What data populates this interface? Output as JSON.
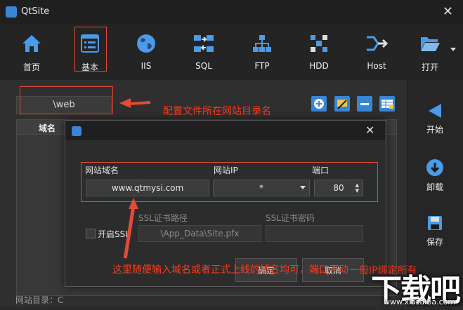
{
  "window": {
    "title": "QtSite",
    "close_icon": "close-icon"
  },
  "toolbar": {
    "items": [
      {
        "label": "首页",
        "icon": "home-icon"
      },
      {
        "label": "基本",
        "icon": "basic-settings-icon"
      },
      {
        "label": "IIS",
        "icon": "globe-icon"
      },
      {
        "label": "SQL",
        "icon": "database-transfer-icon"
      },
      {
        "label": "FTP",
        "icon": "network-tree-icon"
      },
      {
        "label": "HDD",
        "icon": "nodes-icon"
      },
      {
        "label": "Host",
        "icon": "arrows-merge-icon"
      },
      {
        "label": "打开",
        "icon": "folder-open-icon"
      }
    ]
  },
  "main": {
    "dir_value": "\\web",
    "table_header_domain": "域名",
    "site_dir_label": "网站目录：C"
  },
  "sidebar": {
    "start_label": "开始",
    "uninstall_label": "卸载",
    "save_label": "保存"
  },
  "dialog": {
    "domain_label": "网站域名",
    "ip_label": "网站IP",
    "port_label": "端口",
    "domain_value": "www.qtmysi.com",
    "ip_value": "*",
    "port_value": "80",
    "ssl_path_label": "SSL证书路径",
    "ssl_pwd_label": "SSL证书密码",
    "ssl_enable_label": "开启SSL",
    "ssl_path_value": "\\App_Data\\Site.pfx",
    "ok_label": "确定",
    "cancel_label": "取消"
  },
  "annotations": {
    "dir_note": "配置文件所在网站目录名",
    "domain_note": "这里随便输入域名或者正式上线的域名均可，端口不动",
    "domain_note_cont": "一般IP绑定所有"
  },
  "watermark": {
    "big": "下载吧",
    "url": "www.xiazaiba.com"
  },
  "colors": {
    "accent_red": "#e54a36",
    "icon_blue": "#3a86d6"
  }
}
